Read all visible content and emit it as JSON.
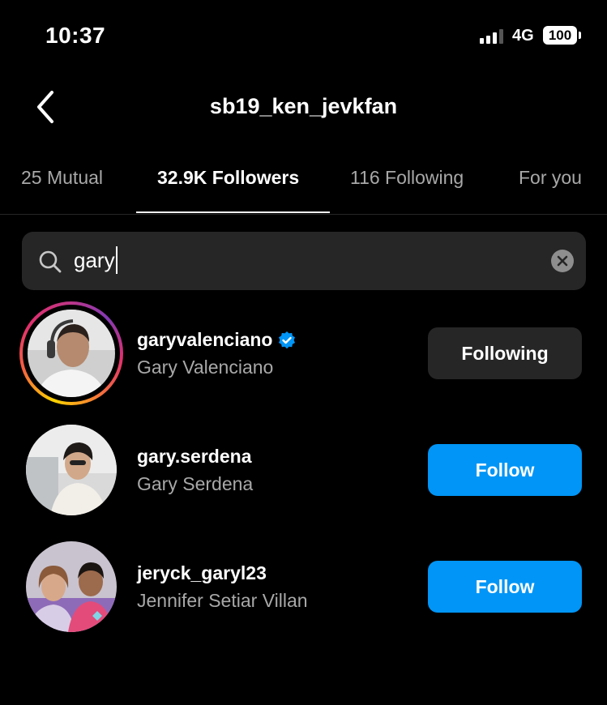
{
  "status_bar": {
    "time": "10:37",
    "network": "4G",
    "battery": "100"
  },
  "header": {
    "title": "sb19_ken_jevkfan",
    "back_icon": "chevron-left-icon"
  },
  "tabs": [
    {
      "label": "25 Mutual",
      "active": false
    },
    {
      "label": "32.9K Followers",
      "active": true
    },
    {
      "label": "116 Following",
      "active": false
    },
    {
      "label": "For you",
      "active": false
    }
  ],
  "search": {
    "value": "gary",
    "icon": "search-icon",
    "clear_icon": "clear-icon"
  },
  "results": [
    {
      "username": "garyvalenciano",
      "full_name": "Gary Valenciano",
      "verified": true,
      "has_story": true,
      "button": "Following"
    },
    {
      "username": "gary.serdena",
      "full_name": "Gary Serdena",
      "verified": false,
      "has_story": false,
      "button": "Follow"
    },
    {
      "username": "jeryck_garyl23",
      "full_name": "Jennifer Setiar Villan",
      "verified": false,
      "has_story": false,
      "button": "Follow"
    }
  ],
  "colors": {
    "background": "#000000",
    "follow_button": "#0095f6",
    "following_button": "#262626",
    "secondary_text": "#a8a8a8",
    "verified_badge": "#0095f6"
  }
}
